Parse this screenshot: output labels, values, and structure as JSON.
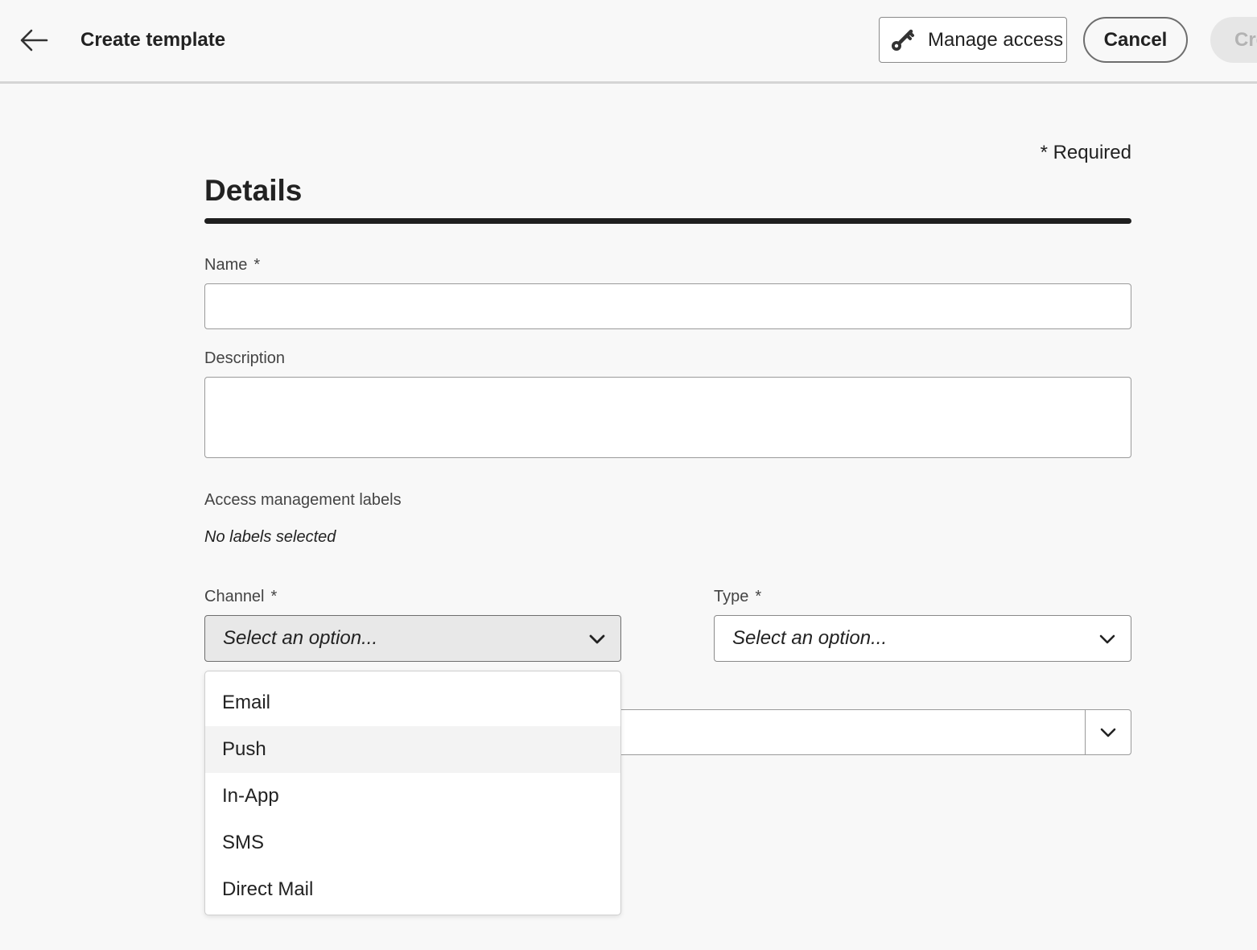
{
  "header": {
    "title": "Create template",
    "manage_access_label": "Manage access",
    "cancel_label": "Cancel",
    "create_label": "Create"
  },
  "form": {
    "required_note": "* Required",
    "section_title": "Details",
    "name": {
      "label": "Name",
      "required_mark": "*",
      "value": ""
    },
    "description": {
      "label": "Description",
      "value": ""
    },
    "access_labels": {
      "label": "Access management labels",
      "empty_text": "No labels selected"
    },
    "channel": {
      "label": "Channel",
      "required_mark": "*",
      "placeholder": "Select an option...",
      "expanded": true,
      "options": [
        "Email",
        "Push",
        "In-App",
        "SMS",
        "Direct Mail"
      ],
      "hovered_option": "Push"
    },
    "type": {
      "label": "Type",
      "required_mark": "*",
      "placeholder": "Select an option..."
    }
  },
  "icons": {
    "back": "arrow-left-icon",
    "manage_access": "key-icon",
    "chevron": "chevron-down-icon"
  },
  "colors": {
    "background": "#f8f8f8",
    "text": "#222222",
    "disabled_text": "#b3b3b3",
    "rule": "#1f1f1f"
  }
}
